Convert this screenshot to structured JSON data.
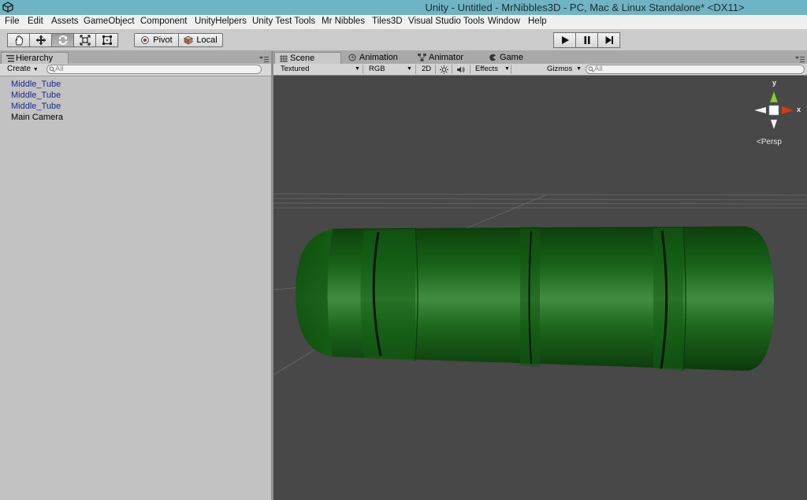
{
  "window": {
    "title": "Unity - Untitled - MrNibbles3D - PC, Mac & Linux Standalone* <DX11>"
  },
  "menu": [
    "File",
    "Edit",
    "Assets",
    "GameObject",
    "Component",
    "UnityHelpers",
    "Unity Test Tools",
    "Mr Nibbles",
    "Tiles3D",
    "Visual Studio Tools",
    "Window",
    "Help"
  ],
  "toolbar": {
    "transform_tools": [
      "hand-tool-icon",
      "move-tool-icon",
      "rotate-tool-icon",
      "scale-tool-icon",
      "rect-tool-icon"
    ],
    "active_tool": "rotate-tool-icon",
    "pivot_label": "Pivot",
    "local_label": "Local",
    "playback": [
      "play-icon",
      "pause-icon",
      "step-icon"
    ]
  },
  "hierarchy": {
    "tab_label": "Hierarchy",
    "create_label": "Create",
    "search_placeholder": "All",
    "items": [
      {
        "label": "Middle_Tube",
        "color": "#1b2a8c"
      },
      {
        "label": "Middle_Tube",
        "color": "#1b2a8c"
      },
      {
        "label": "Middle_Tube",
        "color": "#1b2a8c"
      },
      {
        "label": "Main Camera",
        "color": "#000000"
      }
    ]
  },
  "scene": {
    "tabs": [
      {
        "label": "Scene",
        "icon": "scene-grid-icon",
        "active": true
      },
      {
        "label": "Animation",
        "icon": "clock-icon",
        "active": false
      },
      {
        "label": "Animator",
        "icon": "animator-icon",
        "active": false
      },
      {
        "label": "Game",
        "icon": "pacman-icon",
        "active": false
      }
    ],
    "toolbar": {
      "render_mode": "Textured",
      "color_mode": "RGB",
      "toggle_2d": "2D",
      "effects": "Effects",
      "gizmos": "Gizmos",
      "search_placeholder": "All"
    },
    "gizmo": {
      "y_label": "y",
      "x_label": "x",
      "projection": "Persp"
    },
    "tube_color": "#1c6b1c"
  }
}
